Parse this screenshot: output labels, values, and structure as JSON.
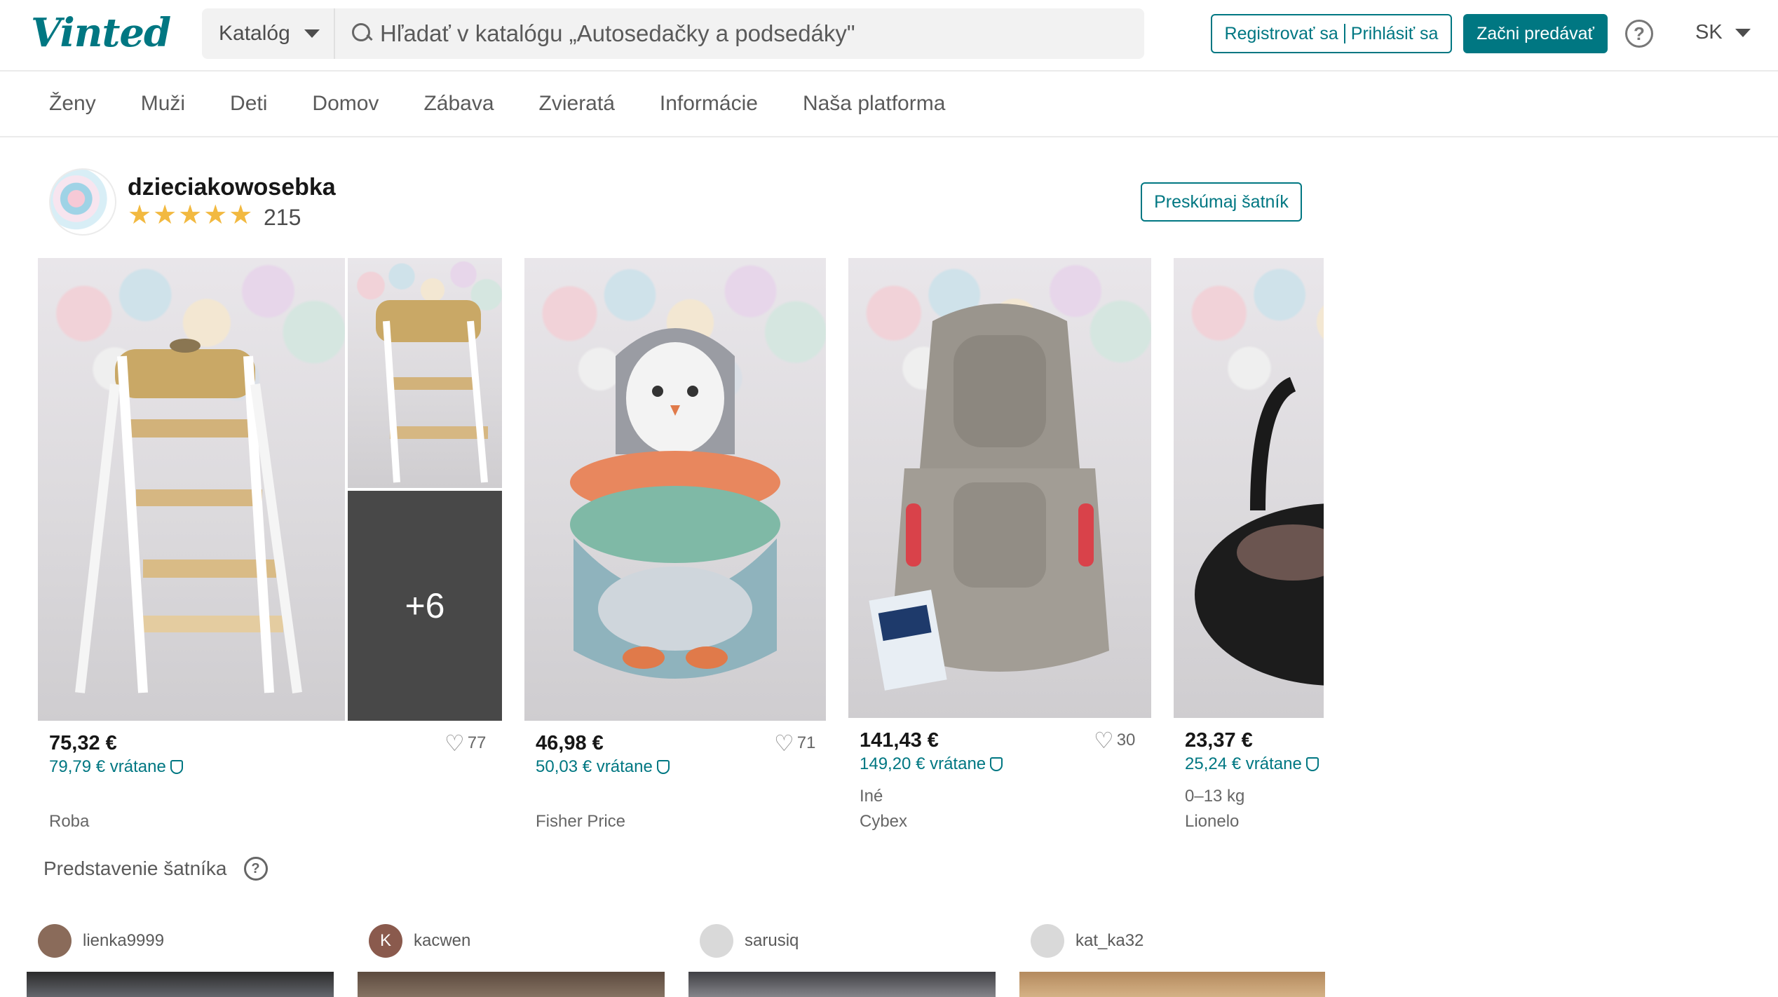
{
  "header": {
    "logo": "Vinted",
    "catalog_label": "Katalóg",
    "search_placeholder": "Hľadať v katalógu „Autosedačky a podsedáky\"",
    "register_label": "Registrovať sa",
    "login_label": "Prihlásiť sa",
    "sell_label": "Začni predávať",
    "help_icon": "question-circle-icon",
    "language": "SK",
    "accent_color": "#007782"
  },
  "nav": {
    "items": [
      "Ženy",
      "Muži",
      "Deti",
      "Domov",
      "Zábava",
      "Zvieratá",
      "Informácie",
      "Naša platforma"
    ]
  },
  "seller": {
    "name": "dzieciakowosebka",
    "stars": "★★★★★",
    "review_count": "215",
    "explore_label": "Preskúmaj šatník"
  },
  "items": [
    {
      "price": "75,32 €",
      "price_incl": "79,79 € vrátane",
      "favorites": "77",
      "size": "",
      "brand": "Roba",
      "extra_photos": "+6"
    },
    {
      "price": "46,98 €",
      "price_incl": "50,03 € vrátane",
      "favorites": "71",
      "size": "",
      "brand": "Fisher Price"
    },
    {
      "price": "141,43 €",
      "price_incl": "149,20 € vrátane",
      "favorites": "30",
      "size": "Iné",
      "brand": "Cybex"
    },
    {
      "price": "23,37 €",
      "price_incl": "25,24 € vrátane",
      "favorites": "",
      "size": "0–13 kg",
      "brand": "Lionelo"
    }
  ],
  "showcase": {
    "title": "Predstavenie šatníka",
    "users": [
      {
        "name": "lienka9999",
        "initial": "",
        "avatar_color": "#8a6b5a"
      },
      {
        "name": "kacwen",
        "initial": "K",
        "avatar_color": "#8a5a4d"
      },
      {
        "name": "sarusiq",
        "initial": "",
        "avatar_color": "#d9d9d9"
      },
      {
        "name": "kat_ka32",
        "initial": "",
        "avatar_color": "#d9d9d9"
      }
    ]
  }
}
